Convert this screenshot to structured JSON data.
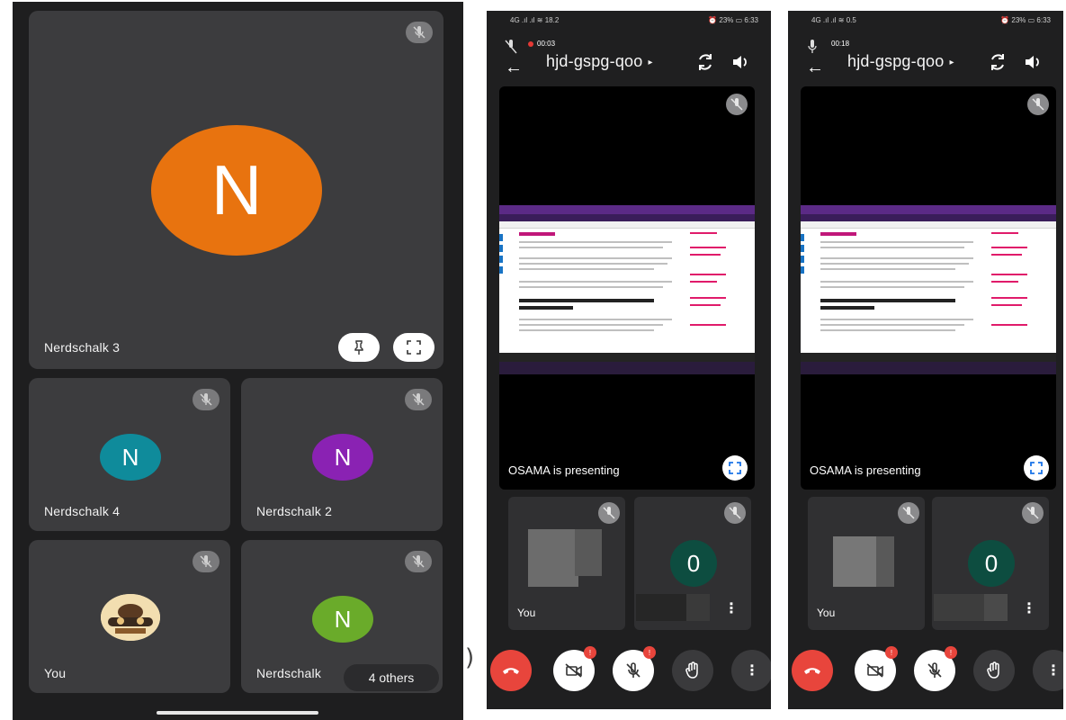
{
  "grid_view": {
    "main_tile": {
      "name": "Nerdschalk 3",
      "initial": "N"
    },
    "tiles": [
      {
        "name": "Nerdschalk 4",
        "initial": "N"
      },
      {
        "name": "Nerdschalk 2",
        "initial": "N"
      },
      {
        "name": "You"
      },
      {
        "name": "Nerdschalk",
        "initial": "N"
      }
    ],
    "others_label": "4 others"
  },
  "separator_glyph": ")",
  "phones": [
    {
      "status_left": "4G  .ıl .ıl ≋ 18.2",
      "status_right": "⏰ 23% ▭ 6:33",
      "timer": "00:03",
      "meeting_code": "hjd-gspg-qoo",
      "caret": "▸",
      "presenting_label": "OSAMA is presenting",
      "you_label": "You",
      "participant_initial": "0",
      "more_glyph": "⋮",
      "badge": "!"
    },
    {
      "status_left": "4G  .ıl .ıl ≋ 0.5",
      "status_right": "⏰ 23% ▭ 6:33",
      "timer": "00:18",
      "meeting_code": "hjd-gspg-qoo",
      "caret": "▸",
      "presenting_label": "OSAMA is presenting",
      "you_label": "You",
      "participant_initial": "0",
      "more_glyph": "⋮",
      "badge": "!"
    }
  ],
  "icons": [
    "mic-off-icon",
    "pin-icon",
    "fullscreen-icon",
    "back-arrow-icon",
    "switch-camera-icon",
    "speaker-icon",
    "expand-icon",
    "end-call-icon",
    "camera-off-icon",
    "hand-raise-icon",
    "more-vert-icon"
  ],
  "colors": {
    "main_avatar": "#e8730f",
    "teal_avatar": "#0f8b9b",
    "purple_avatar": "#8a22b3",
    "green_avatar": "#6aab2a",
    "end_call": "#e8453c"
  }
}
